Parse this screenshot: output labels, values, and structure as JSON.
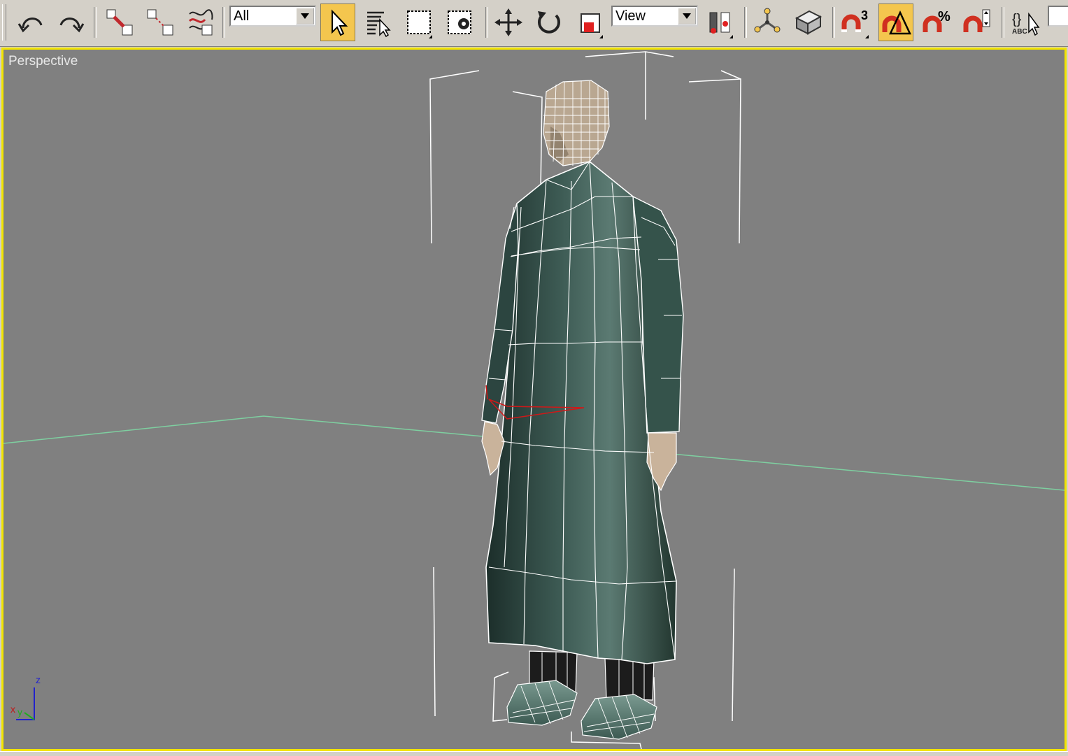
{
  "toolbar": {
    "buttons": [
      {
        "name": "undo-button",
        "icon": "undo-icon"
      },
      {
        "name": "redo-button",
        "icon": "redo-icon"
      },
      {
        "name": "select-and-link-button",
        "icon": "link-icon"
      },
      {
        "name": "unlink-selection-button",
        "icon": "unlink-icon"
      },
      {
        "name": "bind-to-space-warp-button",
        "icon": "space-warp-icon"
      },
      {
        "name": "select-object-button",
        "icon": "cursor-arrow-icon",
        "active": true
      },
      {
        "name": "select-by-name-button",
        "icon": "select-by-name-icon"
      },
      {
        "name": "rectangular-selection-region-button",
        "icon": "selection-rectangle-icon"
      },
      {
        "name": "window-crossing-button",
        "icon": "window-crossing-icon"
      },
      {
        "name": "select-and-move-button",
        "icon": "move-icon"
      },
      {
        "name": "select-and-rotate-button",
        "icon": "rotate-icon"
      },
      {
        "name": "select-and-scale-button",
        "icon": "scale-icon"
      },
      {
        "name": "use-pivot-center-button",
        "icon": "pivot-center-icon"
      },
      {
        "name": "select-and-manipulate-button",
        "icon": "manipulate-icon"
      },
      {
        "name": "keyboard-shortcut-override-button",
        "icon": "keyboard-shortcut-icon"
      },
      {
        "name": "snaps-toggle-button",
        "icon": "snap-magnet-icon",
        "label": "3"
      },
      {
        "name": "angle-snap-toggle-button",
        "icon": "angle-snap-icon",
        "active": true
      },
      {
        "name": "percent-snap-toggle-button",
        "icon": "percent-snap-icon",
        "label": "%"
      },
      {
        "name": "spinner-snap-toggle-button",
        "icon": "spinner-snap-icon"
      },
      {
        "name": "edit-named-selection-sets-button",
        "icon": "named-selection-icon",
        "label": "ABC"
      }
    ],
    "selection_filter": {
      "value": "All"
    },
    "reference_coordinate_system": {
      "value": "View"
    }
  },
  "viewport": {
    "label": "Perspective",
    "border_color": "#f2e400",
    "background_color": "#808080",
    "axis_tripod": {
      "z_label": "z",
      "x_label": "x",
      "y_label": "y"
    }
  },
  "colors": {
    "toolbar_bg": "#d4d0c8",
    "active_button": "#f4c64e",
    "grid_line": "#7ecfa0",
    "wireframe": "#ffffff",
    "coat": "#2f4a44"
  }
}
